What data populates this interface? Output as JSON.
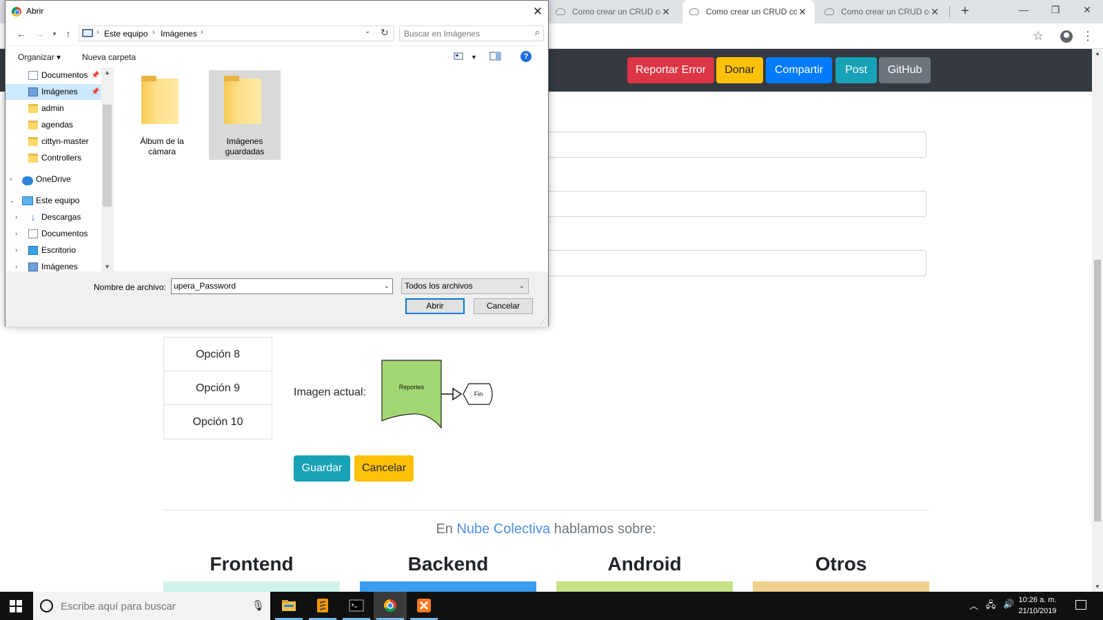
{
  "browser": {
    "tabs": [
      {
        "title": "Como crear un CRUD con"
      },
      {
        "title": "Como crear un CRUD con"
      },
      {
        "title": "Como crear un CRUD con"
      }
    ]
  },
  "page": {
    "nav_buttons": [
      {
        "label": "Reportar Error",
        "color": "#dc3545"
      },
      {
        "label": "Donar",
        "color": "#ffc107"
      },
      {
        "label": "Compartir",
        "color": "#007bff"
      },
      {
        "label": "Post",
        "color": "#17a2b8"
      },
      {
        "label": "GitHub",
        "color": "#6c757d"
      }
    ],
    "options": [
      {
        "label": "Opción 8"
      },
      {
        "label": "Opción 9"
      },
      {
        "label": "Opción 10"
      }
    ],
    "current_image_label": "Imagen actual:",
    "flow_shapes": {
      "box": "Reportes",
      "end": "Fin"
    },
    "save_button": "Guardar",
    "cancel_button": "Cancelar",
    "talk": {
      "prefix": "En ",
      "brand": "Nube Colectiva",
      "suffix": " hablamos sobre:"
    },
    "categories": [
      {
        "label": "Frontend",
        "color": "#d1f2eb"
      },
      {
        "label": "Backend",
        "color": "#3b9cf2"
      },
      {
        "label": "Android",
        "color": "#c5e384"
      },
      {
        "label": "Otros",
        "color": "#f0d08c"
      }
    ]
  },
  "dialog": {
    "title": "Abrir",
    "breadcrumb": [
      "Este equipo",
      "Imágenes"
    ],
    "search_placeholder": "Buscar en Imágenes",
    "organize": "Organizar",
    "new_folder": "Nueva carpeta",
    "nav_items": [
      {
        "label": "Documentos",
        "icon": "document-icon",
        "pinned": true
      },
      {
        "label": "Imágenes",
        "icon": "pictures-icon",
        "pinned": true,
        "selected": true
      },
      {
        "label": "admin",
        "icon": "folder-icon"
      },
      {
        "label": "agendas",
        "icon": "folder-icon"
      },
      {
        "label": "cittyn-master",
        "icon": "folder-icon"
      },
      {
        "label": "Controllers",
        "icon": "folder-icon"
      },
      {
        "label": "OneDrive",
        "icon": "onedrive-icon"
      },
      {
        "label": "Este equipo",
        "icon": "computer-icon",
        "expanded": true
      },
      {
        "label": "Descargas",
        "icon": "downloads-icon"
      },
      {
        "label": "Documentos",
        "icon": "document-icon"
      },
      {
        "label": "Escritorio",
        "icon": "desktop-icon"
      },
      {
        "label": "Imágenes",
        "icon": "pictures-icon"
      }
    ],
    "files": [
      {
        "name": "Álbum de la cámara"
      },
      {
        "name": "Imágenes guardadas",
        "selected": true
      }
    ],
    "filename_label": "Nombre de archivo:",
    "filename_value": "upera_Password",
    "filetype_value": "Todos los archivos",
    "open_button": "Abrir",
    "cancel_button": "Cancelar"
  },
  "taskbar": {
    "search_placeholder": "Escribe aquí para buscar",
    "apps": [
      {
        "icon": "file-explorer-icon"
      },
      {
        "icon": "sublime-text-icon"
      },
      {
        "icon": "terminal-icon"
      },
      {
        "icon": "chrome-icon",
        "active": true
      },
      {
        "icon": "xampp-icon"
      }
    ],
    "time": "10:26 a. m.",
    "date": "21/10/2019"
  }
}
